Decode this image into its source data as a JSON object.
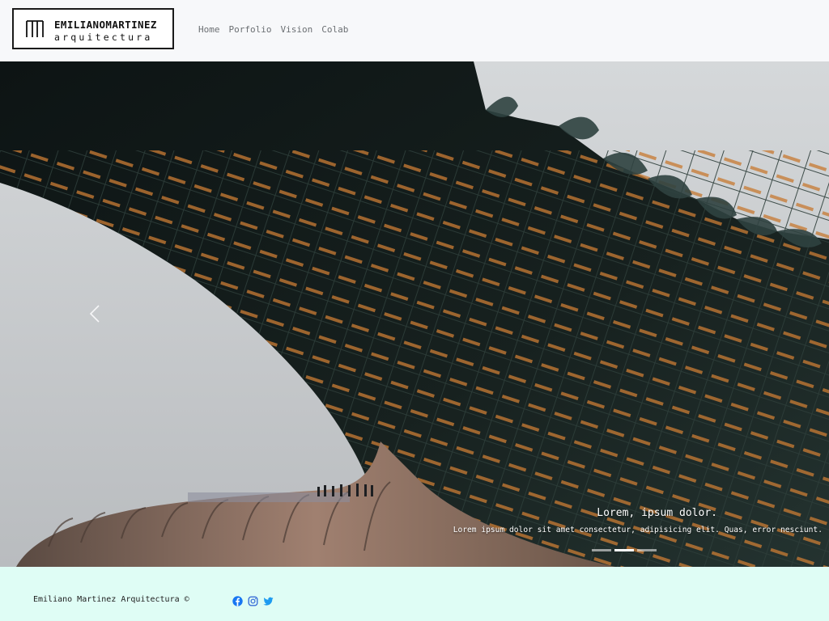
{
  "brand": {
    "name_line1": "EMILIANOMARTINEZ",
    "name_line2": "arquitectura"
  },
  "nav": {
    "items": [
      {
        "label": "Home"
      },
      {
        "label": "Porfolio"
      },
      {
        "label": "Vision"
      },
      {
        "label": "Colab"
      }
    ]
  },
  "carousel": {
    "prev_icon": "chevron-left-icon",
    "slide": {
      "title": "Lorem, ipsum dolor.",
      "text": "Lorem ipsum dolor sit amet consectetur, adipisicing elit. Quas, error nesciunt."
    },
    "indicators": [
      {
        "active": false
      },
      {
        "active": true
      },
      {
        "active": false
      }
    ]
  },
  "footer": {
    "copyright": "Emiliano Martinez Arquitectura ©",
    "socials": [
      {
        "icon": "facebook-icon",
        "color": "#1877f2"
      },
      {
        "icon": "instagram-icon",
        "color": "#3b6fd8"
      },
      {
        "icon": "twitter-icon",
        "color": "#1d9bf0"
      }
    ]
  },
  "colors": {
    "header_bg": "#f7f8fa",
    "footer_bg": "#dffdf5",
    "nav_text": "#6b6f73"
  }
}
